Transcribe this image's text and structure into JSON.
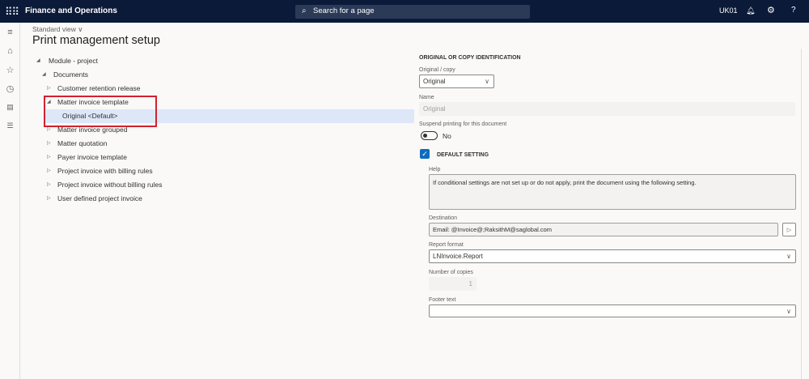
{
  "header": {
    "app_title": "Finance and Operations",
    "search_placeholder": "Search for a page",
    "company": "UK01"
  },
  "page": {
    "view": "Standard view",
    "title": "Print management setup"
  },
  "tree": {
    "module": "Module - project",
    "documents": "Documents",
    "items": [
      "Customer retention release",
      "Matter invoice template",
      "Original <Default>",
      "Matter invoice grouped",
      "Matter quotation",
      "Payer invoice template",
      "Project invoice with billing rules",
      "Project invoice without billing rules",
      "User defined project invoice"
    ]
  },
  "details": {
    "section": "ORIGINAL OR COPY IDENTIFICATION",
    "original_copy_label": "Original / copy",
    "original_copy_value": "Original",
    "name_label": "Name",
    "name_value": "Original",
    "suspend_label": "Suspend printing for this document",
    "suspend_value": "No",
    "default_setting": "DEFAULT SETTING",
    "default_checked": true,
    "help_label": "Help",
    "help_text": "If conditional settings are not set up or do not apply, print the document using the following setting.",
    "destination_label": "Destination",
    "destination_value": "Email: @Invoice@;RaksithM@saglobal.com",
    "report_format_label": "Report format",
    "report_format_value": "LNInvoice.Report",
    "copies_label": "Number of copies",
    "copies_value": "1",
    "footer_label": "Footer text",
    "footer_value": ""
  },
  "colors": {
    "topbar": "#0b1a38",
    "accent": "#0f6cbd",
    "highlight": "#d0232e"
  }
}
